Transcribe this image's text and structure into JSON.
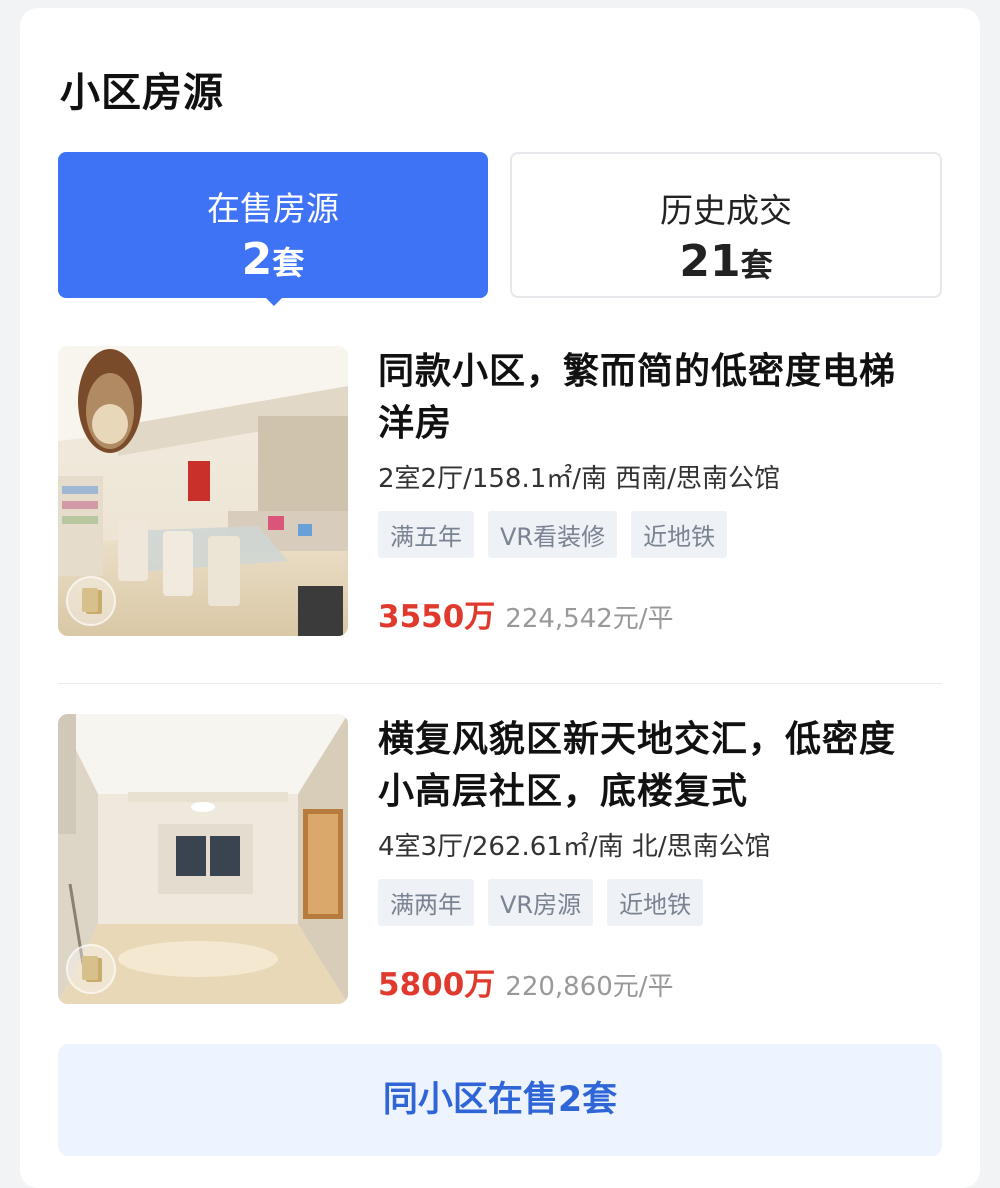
{
  "section": {
    "title": "小区房源"
  },
  "tabs": [
    {
      "label": "在售房源",
      "count": "2",
      "unit": "套",
      "active": true
    },
    {
      "label": "历史成交",
      "count": "21",
      "unit": "套",
      "active": false
    }
  ],
  "listings": [
    {
      "title_line1": "同款小区，繁而简的低密度电梯",
      "title_line2": "洋房",
      "meta": "2室2厅/158.1㎡/南 西南/思南公馆",
      "tags": [
        "满五年",
        "VR看装修",
        "近地铁"
      ],
      "price": "3550万",
      "unit_price": "224,542元/平"
    },
    {
      "title_line1": "横复风貌区新天地交汇，低密度",
      "title_line2": "小高层社区，底楼复式",
      "meta": "4室3厅/262.61㎡/南 北/思南公馆",
      "tags": [
        "满两年",
        "VR房源",
        "近地铁"
      ],
      "price": "5800万",
      "unit_price": "220,860元/平"
    }
  ],
  "more_button": {
    "label": "同小区在售2套"
  },
  "colors": {
    "accent": "#3f73f5",
    "price": "#e03a2f",
    "link": "#2f65d6"
  }
}
